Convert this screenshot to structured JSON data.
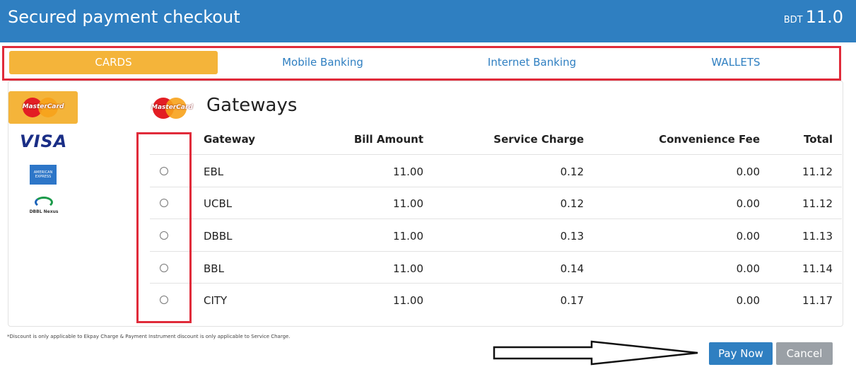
{
  "header": {
    "title": "Secured payment checkout",
    "currency": "BDT",
    "amount": "11.0"
  },
  "tabs": [
    {
      "label": "CARDS",
      "active": true
    },
    {
      "label": "Mobile Banking",
      "active": false
    },
    {
      "label": "Internet Banking",
      "active": false
    },
    {
      "label": "WALLETS",
      "active": false
    }
  ],
  "side_logos": [
    {
      "name": "mastercard",
      "text": "MasterCard",
      "selected": true
    },
    {
      "name": "visa",
      "text": "VISA"
    },
    {
      "name": "amex",
      "text": "AMERICAN EXPRESS"
    },
    {
      "name": "dbbl-nexus",
      "text": "DBBL Nexus"
    }
  ],
  "section": {
    "logo_text": "MasterCard",
    "title": "Gateways"
  },
  "table": {
    "headers": [
      "Gateway",
      "Bill Amount",
      "Service Charge",
      "Convenience Fee",
      "Total"
    ],
    "rows": [
      {
        "gateway": "EBL",
        "bill": "11.00",
        "service": "0.12",
        "convenience": "0.00",
        "total": "11.12"
      },
      {
        "gateway": "UCBL",
        "bill": "11.00",
        "service": "0.12",
        "convenience": "0.00",
        "total": "11.12"
      },
      {
        "gateway": "DBBL",
        "bill": "11.00",
        "service": "0.13",
        "convenience": "0.00",
        "total": "11.13"
      },
      {
        "gateway": "BBL",
        "bill": "11.00",
        "service": "0.14",
        "convenience": "0.00",
        "total": "11.14"
      },
      {
        "gateway": "CITY",
        "bill": "11.00",
        "service": "0.17",
        "convenience": "0.00",
        "total": "11.17"
      }
    ]
  },
  "note": "*Discount is only applicable to Ekpay Charge & Payment Instrument discount is only applicable to Service Charge.",
  "buttons": {
    "pay": "Pay Now",
    "cancel": "Cancel"
  },
  "colors": {
    "header_bg": "#2f7fc1",
    "active_tab": "#f4b43a",
    "annotation": "#e02b3a",
    "pay_button": "#2f7fc1",
    "cancel_button": "#9aa0a6"
  }
}
